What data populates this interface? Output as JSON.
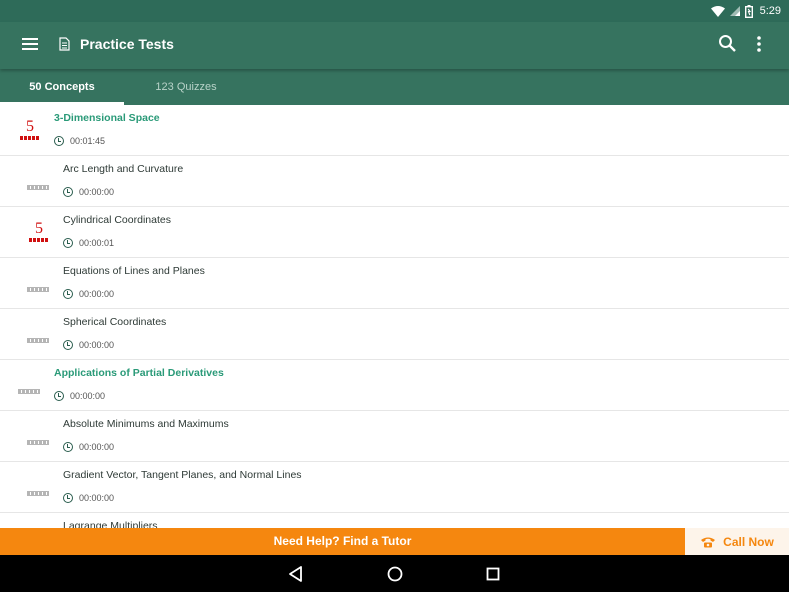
{
  "status_bar": {
    "time": "5:29"
  },
  "app_bar": {
    "title": "Practice Tests"
  },
  "tabs": [
    {
      "label": "50 Concepts",
      "selected": true
    },
    {
      "label": "123 Quizzes",
      "selected": false
    }
  ],
  "rows": [
    {
      "title": "3-Dimensional Space",
      "time": "00:01:45",
      "score": "5",
      "section": true
    },
    {
      "title": "Arc Length and Curvature",
      "time": "00:00:00",
      "score": "",
      "section": false
    },
    {
      "title": "Cylindrical Coordinates",
      "time": "00:00:01",
      "score": "5",
      "section": false
    },
    {
      "title": "Equations of Lines and Planes",
      "time": "00:00:00",
      "score": "",
      "section": false
    },
    {
      "title": "Spherical Coordinates",
      "time": "00:00:00",
      "score": "",
      "section": false
    },
    {
      "title": "Applications of Partial Derivatives",
      "time": "00:00:00",
      "score": "",
      "section": true
    },
    {
      "title": "Absolute Minimums and Maximums",
      "time": "00:00:00",
      "score": "",
      "section": false
    },
    {
      "title": "Gradient Vector, Tangent Planes, and Normal Lines",
      "time": "00:00:00",
      "score": "",
      "section": false
    },
    {
      "title": "Lagrange Multipliers",
      "time": "",
      "score": "",
      "section": false
    }
  ],
  "help_bar": {
    "text": "Need Help? Find a Tutor",
    "call_label": "Call Now"
  },
  "colors": {
    "primary": "#36735f",
    "accent": "#f5870f",
    "section_title": "#2a9a78",
    "score_red": "#d01010"
  },
  "icons": [
    "wifi-icon",
    "signal-icon",
    "battery-icon",
    "menu-icon",
    "document-icon",
    "search-icon",
    "more-vert-icon",
    "clock-icon",
    "phone-icon",
    "back-icon",
    "home-icon",
    "recents-icon"
  ]
}
